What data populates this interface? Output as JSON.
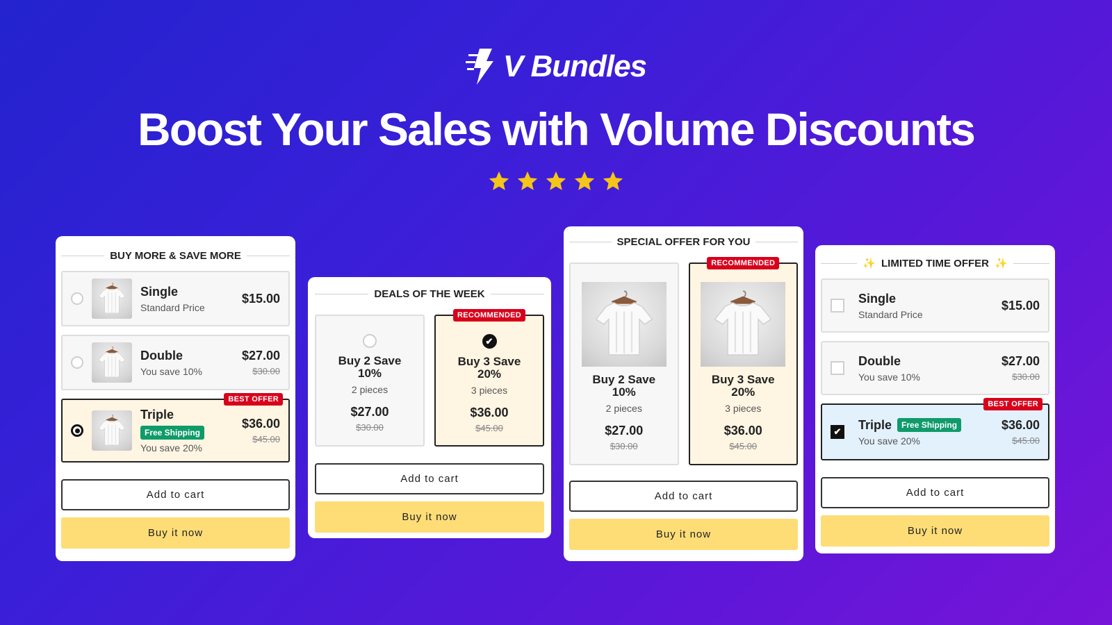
{
  "brand": {
    "name": "V Bundles",
    "logo_icon": "lightning-bolt-icon"
  },
  "headline": "Boost Your Sales with Volume Discounts",
  "rating": {
    "stars": 5,
    "max": 5,
    "color": "#f5c518"
  },
  "colors": {
    "background_start": "#2323cf",
    "background_end": "#7714d8",
    "badge_red": "#d9001b",
    "badge_green": "#0f9b6a",
    "buy_now_yellow": "#fedd77",
    "selected_cream": "#fff5e3",
    "selected_blue": "#e3f1fd"
  },
  "widgets": [
    {
      "title": "BUY MORE & SAVE MORE",
      "style": "list-radio-thumbnail",
      "options": [
        {
          "name": "Single",
          "subtitle": "Standard Price",
          "price": "$15.00",
          "selected": false
        },
        {
          "name": "Double",
          "subtitle": "You save 10%",
          "price": "$27.00",
          "old_price": "$30.00",
          "selected": false
        },
        {
          "name": "Triple",
          "badge": "Free Shipping",
          "subtitle": "You save 20%",
          "price": "$36.00",
          "old_price": "$45.00",
          "corner_badge": "BEST OFFER",
          "selected": true
        }
      ],
      "add_to_cart": "Add to cart",
      "buy_now": "Buy it now"
    },
    {
      "title": "DEALS OF THE WEEK",
      "style": "tiles-radio",
      "options": [
        {
          "name": "Buy 2 Save",
          "name2": "10%",
          "subtitle": "2 pieces",
          "price": "$27.00",
          "old_price": "$30.00",
          "selected": false
        },
        {
          "name": "Buy 3 Save",
          "name2": "20%",
          "subtitle": "3 pieces",
          "price": "$36.00",
          "old_price": "$45.00",
          "corner_badge": "RECOMMENDED",
          "selected": true
        }
      ],
      "add_to_cart": "Add to cart",
      "buy_now": "Buy it now"
    },
    {
      "title": "SPECIAL OFFER FOR YOU",
      "style": "tiles-image",
      "options": [
        {
          "name": "Buy 2 Save",
          "name2": "10%",
          "subtitle": "2 pieces",
          "price": "$27.00",
          "old_price": "$30.00",
          "selected": false
        },
        {
          "name": "Buy 3 Save",
          "name2": "20%",
          "subtitle": "3 pieces",
          "price": "$36.00",
          "old_price": "$45.00",
          "corner_badge": "RECOMMENDED",
          "selected": true
        }
      ],
      "add_to_cart": "Add to cart",
      "buy_now": "Buy it now"
    },
    {
      "title": "LIMITED TIME OFFER",
      "title_icon": "sparkles-icon",
      "style": "list-checkbox",
      "options": [
        {
          "name": "Single",
          "subtitle": "Standard Price",
          "price": "$15.00",
          "selected": false
        },
        {
          "name": "Double",
          "subtitle": "You save 10%",
          "price": "$27.00",
          "old_price": "$30.00",
          "selected": false
        },
        {
          "name": "Triple",
          "badge": "Free Shipping",
          "subtitle": "You save 20%",
          "price": "$36.00",
          "old_price": "$45.00",
          "corner_badge": "BEST OFFER",
          "selected": true
        }
      ],
      "add_to_cart": "Add to cart",
      "buy_now": "Buy it now"
    }
  ]
}
